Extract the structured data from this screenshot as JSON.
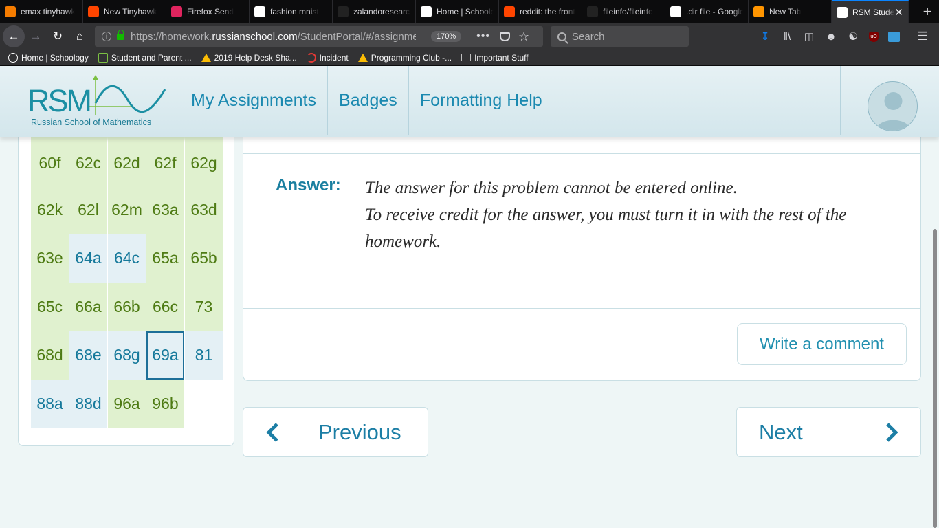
{
  "browser": {
    "tabs": [
      {
        "title": "emax tinyhawk",
        "favicon": "bg-icon",
        "color": "#f57c00"
      },
      {
        "title": "New Tinyhawk",
        "favicon": "reddit-icon",
        "color": "#ff4500"
      },
      {
        "title": "Firefox Send",
        "favicon": "firefox-send-icon",
        "color": "#e0245e"
      },
      {
        "title": "fashion mnist",
        "favicon": "google-icon",
        "color": "#ffffff"
      },
      {
        "title": "zalandoresearch",
        "favicon": "github-icon",
        "color": "#222222"
      },
      {
        "title": "Home | Schoology",
        "favicon": "schoology-icon",
        "color": "#ffffff"
      },
      {
        "title": "reddit: the front",
        "favicon": "reddit-icon",
        "color": "#ff4500"
      },
      {
        "title": "fileinfo/fileinfo",
        "favicon": "github-icon",
        "color": "#222222"
      },
      {
        "title": ".dir file - Google",
        "favicon": "google-icon",
        "color": "#ffffff"
      },
      {
        "title": "New Tab",
        "favicon": "firefox-icon",
        "color": "#ff9500"
      },
      {
        "title": "RSM Student",
        "favicon": "rsm-icon",
        "color": "#ffffff",
        "active": true
      }
    ],
    "url_prefix": "https://homework.",
    "url_host": "russianschool.com",
    "url_path": "/StudentPortal/#/assignments",
    "zoom": "170%",
    "search_placeholder": "Search",
    "bookmarks": [
      {
        "label": "Home | Schoology",
        "icon": "schoology-icon"
      },
      {
        "label": "Student and Parent ...",
        "icon": "parent-portal-icon"
      },
      {
        "label": "2019 Help Desk Sha...",
        "icon": "google-drive-icon"
      },
      {
        "label": "Incident",
        "icon": "incident-icon"
      },
      {
        "label": "Programming Club -...",
        "icon": "google-drive-icon"
      },
      {
        "label": "Important Stuff",
        "icon": "folder-icon"
      }
    ]
  },
  "site": {
    "logo_text": "RSM",
    "logo_subtitle": "Russian School of Mathematics",
    "nav": [
      "My Assignments",
      "Badges",
      "Formatting Help"
    ],
    "brand_color": "#1b89b0"
  },
  "problems": {
    "cells": [
      {
        "label": "60f",
        "status": "done"
      },
      {
        "label": "62c",
        "status": "done"
      },
      {
        "label": "62d",
        "status": "done"
      },
      {
        "label": "62f",
        "status": "done"
      },
      {
        "label": "62g",
        "status": "done"
      },
      {
        "label": "62k",
        "status": "done"
      },
      {
        "label": "62l",
        "status": "done"
      },
      {
        "label": "62m",
        "status": "done"
      },
      {
        "label": "63a",
        "status": "done"
      },
      {
        "label": "63d",
        "status": "done"
      },
      {
        "label": "63e",
        "status": "done"
      },
      {
        "label": "64a",
        "status": "todo"
      },
      {
        "label": "64c",
        "status": "todo"
      },
      {
        "label": "65a",
        "status": "done"
      },
      {
        "label": "65b",
        "status": "done"
      },
      {
        "label": "65c",
        "status": "done"
      },
      {
        "label": "66a",
        "status": "done"
      },
      {
        "label": "66b",
        "status": "done"
      },
      {
        "label": "66c",
        "status": "done"
      },
      {
        "label": "73",
        "status": "done"
      },
      {
        "label": "68d",
        "status": "done"
      },
      {
        "label": "68e",
        "status": "todo"
      },
      {
        "label": "68g",
        "status": "todo"
      },
      {
        "label": "69a",
        "status": "current"
      },
      {
        "label": "81",
        "status": "todo"
      },
      {
        "label": "88a",
        "status": "todo"
      },
      {
        "label": "88d",
        "status": "todo"
      },
      {
        "label": "96a",
        "status": "done"
      },
      {
        "label": "96b",
        "status": "done"
      }
    ],
    "done_color": "#e0f1cf",
    "todo_color": "#e4f0f5"
  },
  "answer": {
    "label": "Answer:",
    "line1": "The answer for this problem cannot be entered online.",
    "line2": "To receive credit for the answer, you must turn it in with the rest of the homework."
  },
  "actions": {
    "comment": "Write a comment",
    "previous": "Previous",
    "next": "Next"
  }
}
